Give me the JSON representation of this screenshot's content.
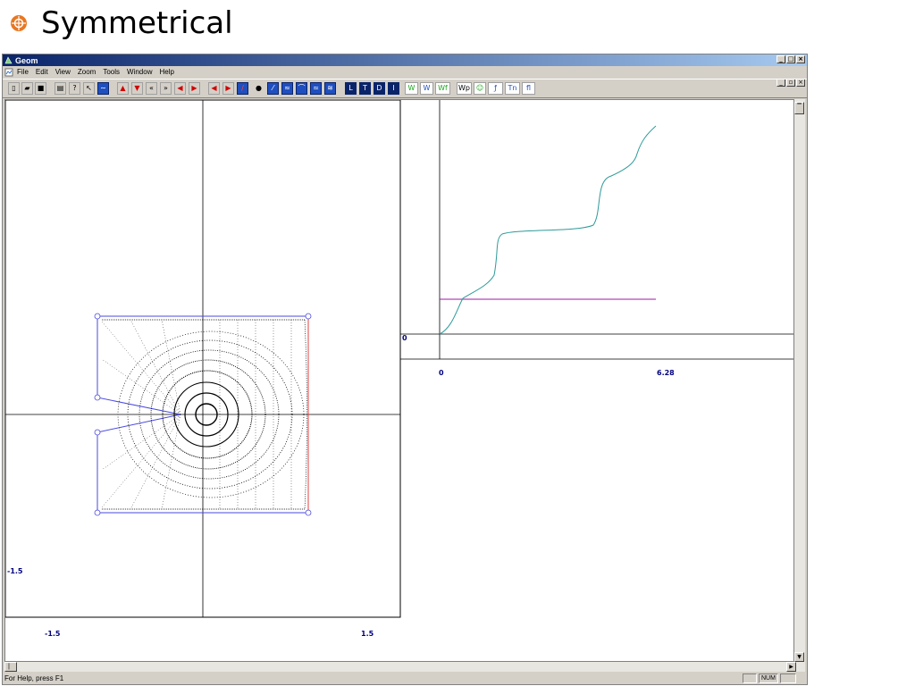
{
  "slide": {
    "title": "Symmetrical"
  },
  "window": {
    "title": "Geom",
    "menu": [
      "File",
      "Edit",
      "View",
      "Zoom",
      "Tools",
      "Window",
      "Help"
    ],
    "toolbar_text": [
      "W",
      "W",
      "Wf",
      "Wp",
      "Tn",
      "fl"
    ],
    "status": {
      "help": "For Help, press F1",
      "num": "NUM"
    }
  },
  "left_plot": {
    "x_min_label": "-1.5",
    "x_max_label": "1.5",
    "y_min_label": "-1.5"
  },
  "right_plot": {
    "x_start_label": "0",
    "x_end_label": "6.28",
    "y_zero_label": "0"
  },
  "colors": {
    "accent_bullet": "#e87722",
    "curve": "#2e9a9a",
    "reference_line": "#9a1aa3",
    "axis_label": "#000080"
  }
}
